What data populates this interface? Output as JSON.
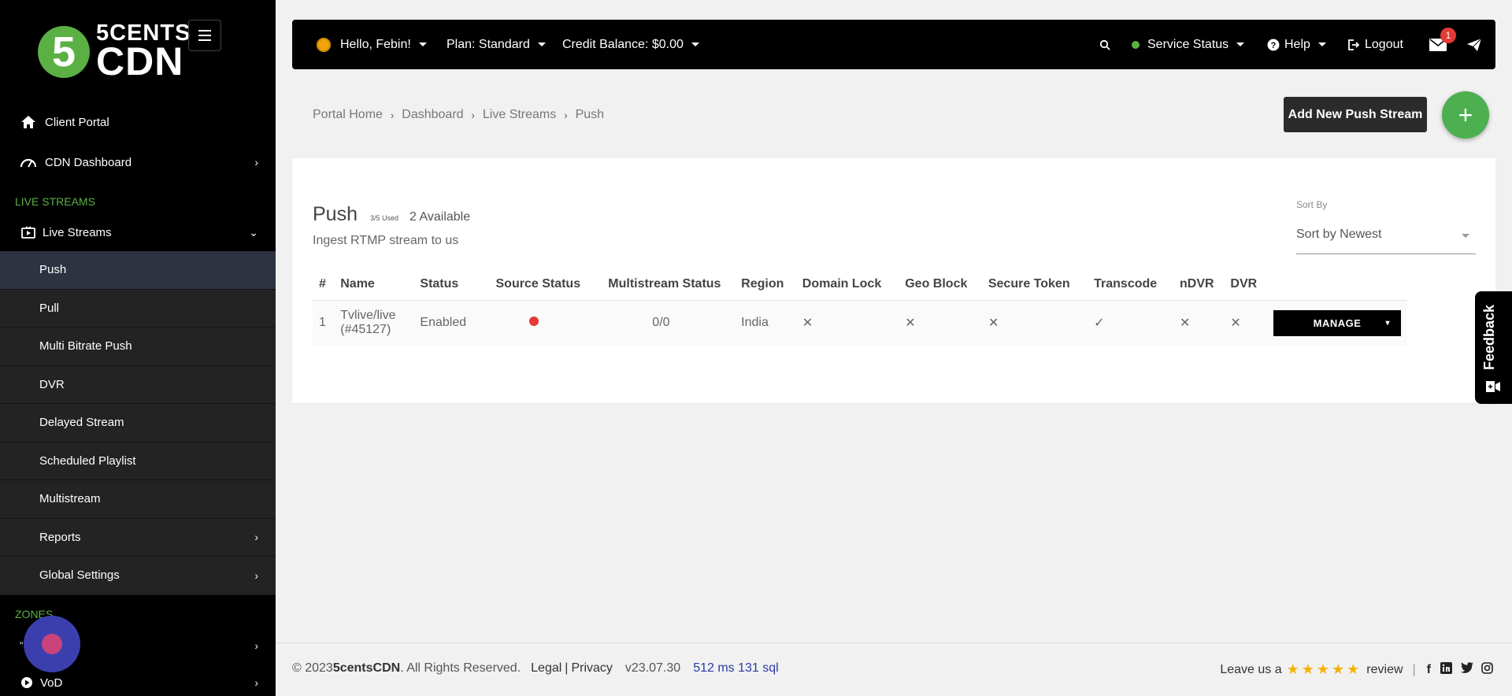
{
  "logo": {
    "mark": "5",
    "line1": "5CENTS",
    "line2": "CDN"
  },
  "sidebar": {
    "client_portal": "Client Portal",
    "cdn_dashboard": "CDN Dashboard",
    "live_streams_section": "LIVE STREAMS",
    "live_streams": "Live Streams",
    "sub_items": [
      "Push",
      "Pull",
      "Multi Bitrate Push",
      "DVR",
      "Delayed Stream",
      "Scheduled Playlist",
      "Multistream",
      "Reports",
      "Global Settings"
    ],
    "zones_section": "ZONES",
    "zone_item_1": "\"",
    "vod": "VoD"
  },
  "topbar": {
    "greeting": "Hello, Febin!",
    "plan": "Plan: Standard",
    "credit": "Credit Balance: $0.00",
    "service_status": "Service Status",
    "help": "Help",
    "logout": "Logout",
    "notification_count": "1"
  },
  "breadcrumb": [
    "Portal Home",
    "Dashboard",
    "Live Streams",
    "Push"
  ],
  "actions": {
    "add_button": "Add New Push Stream",
    "plus": "+"
  },
  "card": {
    "title": "Push",
    "used": "3/5 Used",
    "available": "2 Available",
    "subtitle": "Ingest RTMP stream to us",
    "sort_label": "Sort By",
    "sort_value": "Sort by Newest"
  },
  "table": {
    "headers": [
      "#",
      "Name",
      "Status",
      "Source Status",
      "Multistream Status",
      "Region",
      "Domain Lock",
      "Geo Block",
      "Secure Token",
      "Transcode",
      "nDVR",
      "DVR"
    ],
    "row": {
      "num": "1",
      "name_line1": "Tvlive/live",
      "name_line2": "(#45127)",
      "status": "Enabled",
      "source_status": "offline",
      "multistream": "0/0",
      "region": "India",
      "domain_lock": "✕",
      "geo_block": "✕",
      "secure_token": "✕",
      "transcode": "✓",
      "ndvr": "✕",
      "dvr": "✕",
      "manage": "MANAGE"
    }
  },
  "feedback": "Feedback",
  "footer": {
    "copyright": "© 2023 ",
    "brand": "5centsCDN",
    "rights": ". All Rights Reserved.",
    "legal": "Legal",
    "privacy": "Privacy",
    "version": "v23.07.30",
    "perf": "512 ms 131 sql",
    "review_prefix": "Leave us a",
    "review_suffix": "review",
    "stars": "★★★★★"
  },
  "colors": {
    "accent_green": "#5bb043",
    "sidebar_bg": "#000000",
    "active_item": "#2d3341",
    "fab_green": "#4caf50",
    "status_red": "#e53935"
  }
}
